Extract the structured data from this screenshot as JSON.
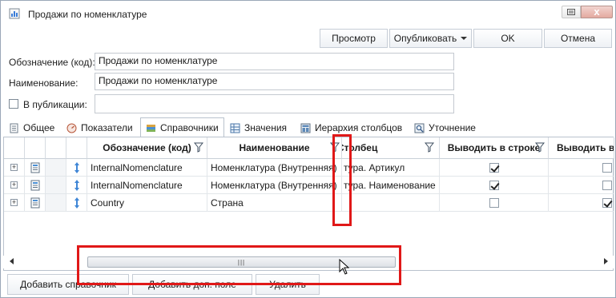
{
  "window": {
    "title": "Продажи по номенклатуре",
    "close_glyph": "x",
    "minimize_glyph": "▭"
  },
  "toolbar": {
    "preview_label": "Просмотр",
    "publish_label": "Опубликовать",
    "ok_label": "OK",
    "cancel_label": "Отмена"
  },
  "form": {
    "code_label": "Обозначение (код):",
    "code_value": "Продажи по номенклатуре",
    "name_label": "Наименование:",
    "name_value": "Продажи по номенклатуре",
    "in_publication_label": "В публикации:",
    "in_publication_value": ""
  },
  "tabs": [
    {
      "label": "Общее",
      "icon": "document-icon"
    },
    {
      "label": "Показатели",
      "icon": "gauge-icon"
    },
    {
      "label": "Справочники",
      "icon": "books-icon",
      "active": true
    },
    {
      "label": "Значения",
      "icon": "table-icon"
    },
    {
      "label": "Иерархия столбцов",
      "icon": "hierarchy-icon"
    },
    {
      "label": "Уточнение",
      "icon": "refine-icon"
    }
  ],
  "grid": {
    "columns": {
      "code": "Обозначение (код)",
      "name": "Наименование",
      "column": "Столбец",
      "in_row": "Выводить в строке",
      "in_col": "Выводить в с"
    },
    "rows": [
      {
        "code": "InternalNomenclature",
        "name": "Номенклатура (Внутренняя)",
        "column": "тура. Артикул",
        "in_row": true,
        "in_col": false
      },
      {
        "code": "InternalNomenclature",
        "name": "Номенклатура (Внутренняя)",
        "column": "тура. Наименование",
        "in_row": true,
        "in_col": false
      },
      {
        "code": "Country",
        "name": "Страна",
        "column": "",
        "in_row": false,
        "in_col": true
      }
    ]
  },
  "bottom": {
    "add_ref_label": "Добавить справочник",
    "add_extra_label": "Добавить доп. поле",
    "delete_label": "Удалить"
  },
  "colors": {
    "highlight": "#e01818",
    "border": "#b9c2cd"
  }
}
